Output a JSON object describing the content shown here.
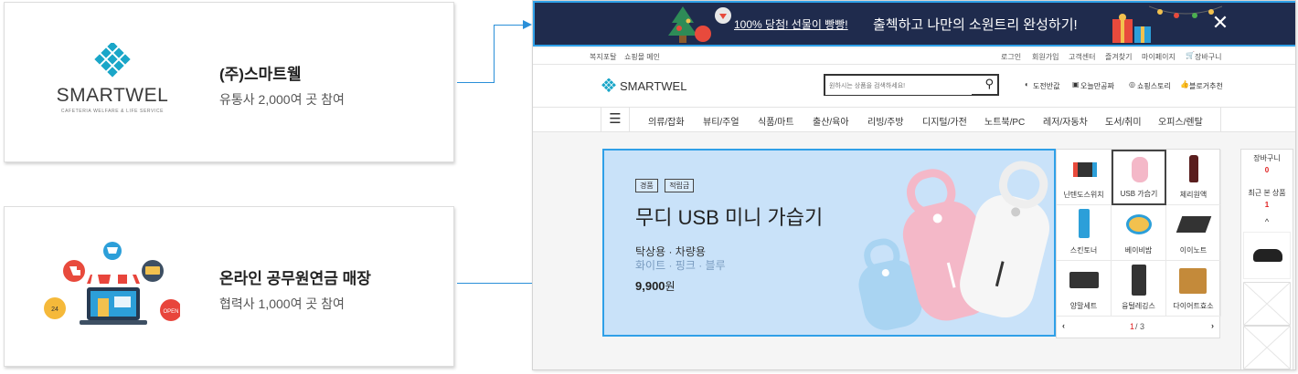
{
  "cards": [
    {
      "title": "(주)스마트웰",
      "subtitle": "유통사 2,000여 곳 참여",
      "logo_text": "SMARTWEL",
      "logo_tagline": "CAFETERIA WELFARE & LIFE SERVICE"
    },
    {
      "title": "온라인 공무원연금 매장",
      "subtitle": "협력사 1,000여 곳 참여",
      "badge_24": "24",
      "badge_open": "OPEN"
    }
  ],
  "banner": {
    "promo": "100% 당첨! 선물이 빵빵!",
    "headline": "출첵하고 나만의 소원트리 완성하기!"
  },
  "topbar": {
    "left": [
      "복지포탈",
      "쇼핑몰 메인"
    ],
    "right": [
      "로그인",
      "회원가입",
      "고객센터",
      "즐겨찾기",
      "마이페이지",
      "장바구니"
    ]
  },
  "header": {
    "logo": "SMARTWEL",
    "search_placeholder": "원하시는 상품을 검색하세요!",
    "links": [
      "도전반값",
      "오늘만공짜",
      "쇼핑스토리",
      "블로거추천"
    ]
  },
  "nav": {
    "items": [
      "의류/잡화",
      "뷰티/주얼",
      "식품/마트",
      "출산/육아",
      "리빙/주방",
      "디지털/가전",
      "노트북/PC",
      "레저/자동차",
      "도서/취미",
      "오피스/렌탈"
    ]
  },
  "hero": {
    "tags": [
      "경품",
      "적립금"
    ],
    "title": "무디 USB 미니 가습기",
    "line1": "탁상용 · 차량용",
    "line2": "화이트 · 핑크 · 블루",
    "price": "9,900",
    "price_unit": "원"
  },
  "products": [
    {
      "label": "닌텐도스위치"
    },
    {
      "label": "USB 가습기"
    },
    {
      "label": "체리원액"
    },
    {
      "label": "스킨토너"
    },
    {
      "label": "베이비밤"
    },
    {
      "label": "이이노트"
    },
    {
      "label": "양말세트"
    },
    {
      "label": "융털레깅스"
    },
    {
      "label": "다이어트효소"
    }
  ],
  "pager": {
    "current": "1",
    "total": "/ 3"
  },
  "sidebar": {
    "cart_label": "장바구니",
    "cart_count": "0",
    "recent_label": "최근 본 상품",
    "recent_count": "1"
  },
  "colors": {
    "accent": "#2fa0e8",
    "banner_bg": "#1f2b4d",
    "hero_bg": "#c9e2f9",
    "red": "#e02020",
    "logo_teal": "#1aa6c8"
  }
}
